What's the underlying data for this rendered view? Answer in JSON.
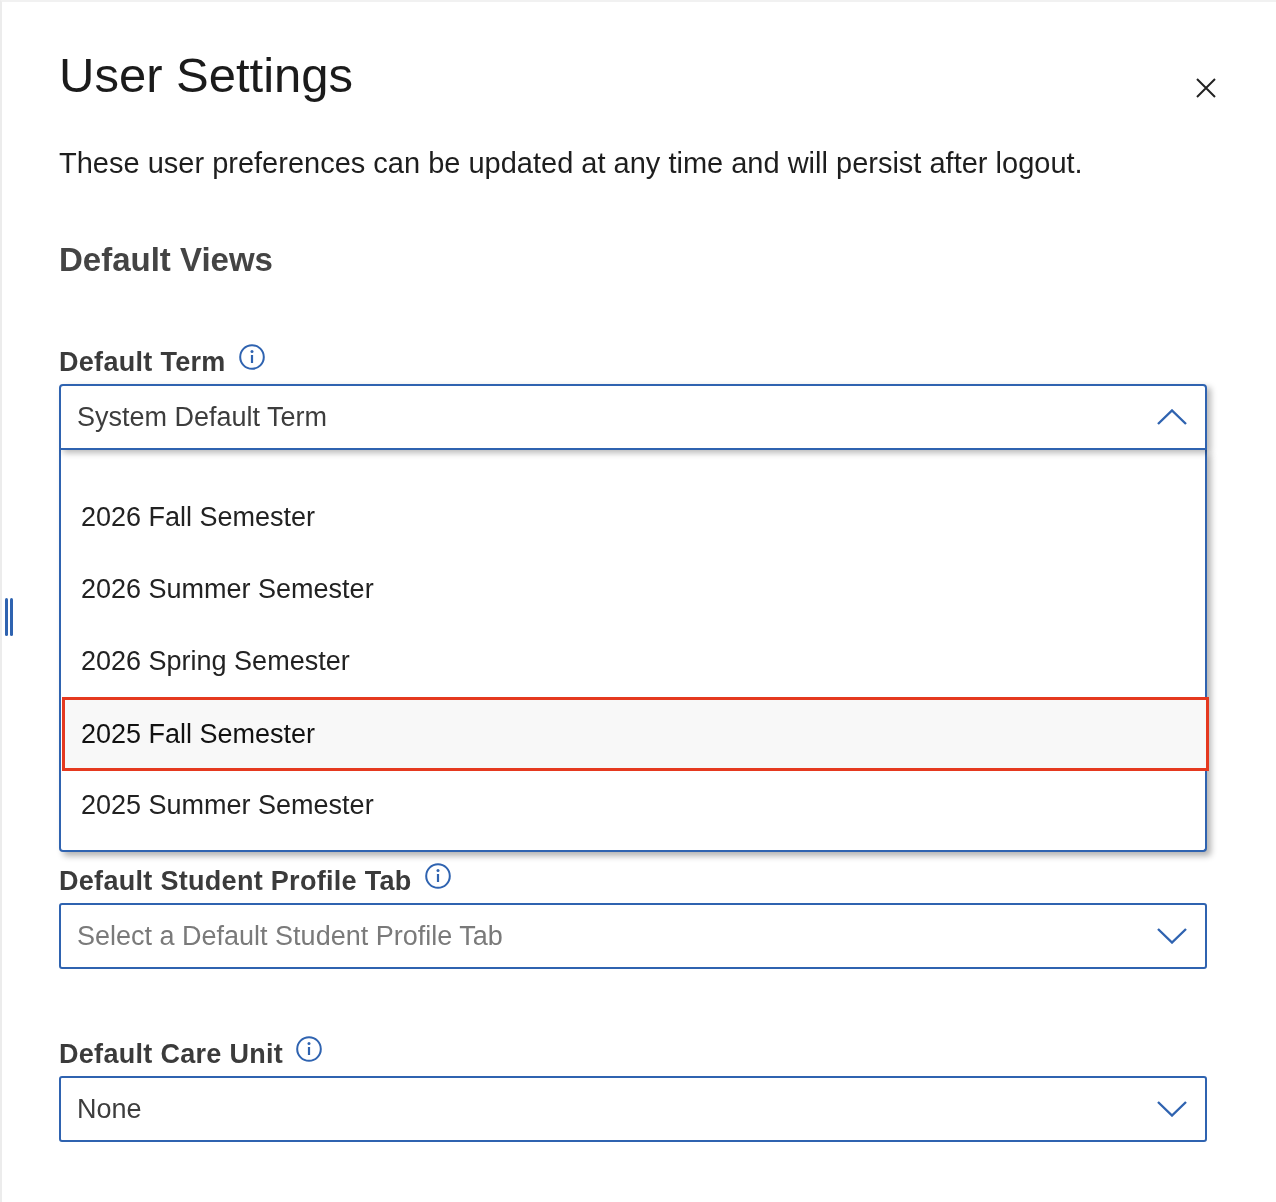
{
  "dialog": {
    "title": "User Settings",
    "description": "These user preferences can be updated at any time and will persist after logout."
  },
  "section": {
    "heading": "Default Views"
  },
  "fields": [
    {
      "label": "Default Term",
      "value": "System Default Term",
      "expanded": true,
      "options": [
        {
          "label": "2026 Fall Semester",
          "highlighted": false
        },
        {
          "label": "2026 Summer Semester",
          "highlighted": false
        },
        {
          "label": "2026 Spring Semester",
          "highlighted": false
        },
        {
          "label": "2025 Fall Semester",
          "highlighted": true
        },
        {
          "label": "2025 Summer Semester",
          "highlighted": false
        }
      ]
    },
    {
      "label": "Default Student Profile Tab",
      "placeholder": "Select a Default Student Profile Tab",
      "expanded": false
    },
    {
      "label": "Default Care Unit",
      "value": "None",
      "expanded": false
    }
  ]
}
